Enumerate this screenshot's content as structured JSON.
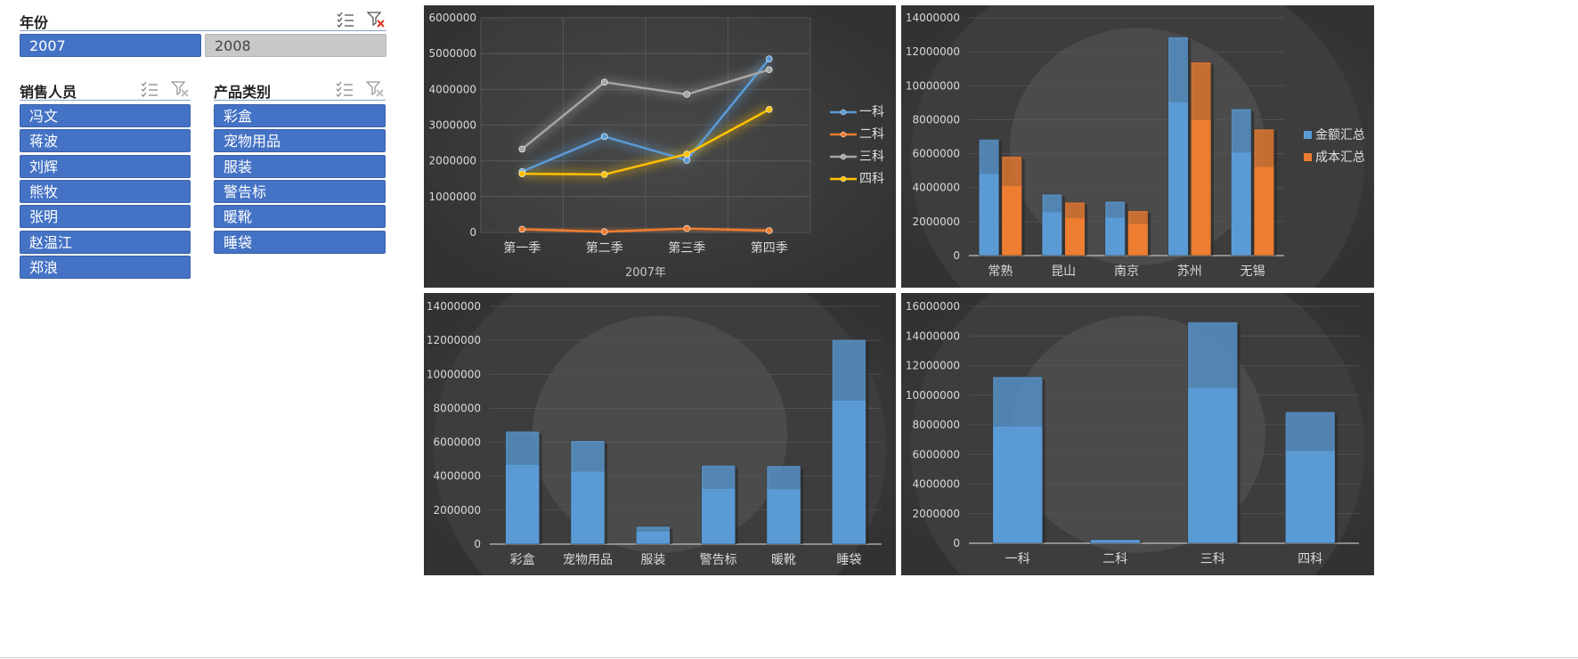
{
  "slicers": {
    "year": {
      "title": "年份",
      "items": [
        {
          "label": "2007",
          "selected": true
        },
        {
          "label": "2008",
          "selected": false
        }
      ]
    },
    "salesperson": {
      "title": "销售人员",
      "items": [
        {
          "label": "冯文",
          "selected": true
        },
        {
          "label": "蒋波",
          "selected": true
        },
        {
          "label": "刘辉",
          "selected": true
        },
        {
          "label": "熊牧",
          "selected": true
        },
        {
          "label": "张明",
          "selected": true
        },
        {
          "label": "赵温江",
          "selected": true
        },
        {
          "label": "郑浪",
          "selected": true
        }
      ]
    },
    "category": {
      "title": "产品类别",
      "items": [
        {
          "label": "彩盒",
          "selected": true
        },
        {
          "label": "宠物用品",
          "selected": true
        },
        {
          "label": "服装",
          "selected": true
        },
        {
          "label": "警告标",
          "selected": true
        },
        {
          "label": "暖靴",
          "selected": true
        },
        {
          "label": "睡袋",
          "selected": true
        }
      ]
    }
  },
  "icons": {
    "multi_select": "multi-select-icon",
    "clear_filter": "clear-filter-icon"
  },
  "colors": {
    "slicer_selected": "#4472c4",
    "slicer_unselected": "#c8c8c8",
    "chart_bg": "#3b3b3b",
    "blue": "#5b9bd5",
    "orange": "#ed7d31",
    "gray": "#a5a5a5",
    "yellow": "#ffc000"
  },
  "chart_data": [
    {
      "id": "quarterly",
      "type": "line",
      "categories": [
        "第一季",
        "第二季",
        "第三季",
        "第四季"
      ],
      "xlabel": "2007年",
      "ylim": [
        0,
        6000000
      ],
      "yticks": [
        0,
        1000000,
        2000000,
        3000000,
        4000000,
        5000000,
        6000000
      ],
      "grid": true,
      "legend": "right",
      "series": [
        {
          "name": "一科",
          "color": "#5b9bd5",
          "values": [
            1700000,
            2680000,
            2020000,
            4850000
          ]
        },
        {
          "name": "二科",
          "color": "#ed7d31",
          "values": [
            90000,
            20000,
            110000,
            50000
          ]
        },
        {
          "name": "三科",
          "color": "#a5a5a5",
          "values": [
            2330000,
            4200000,
            3860000,
            4550000
          ]
        },
        {
          "name": "四科",
          "color": "#ffc000",
          "values": [
            1640000,
            1620000,
            2190000,
            3440000
          ]
        }
      ]
    },
    {
      "id": "city",
      "type": "bar",
      "categories": [
        "常熟",
        "昆山",
        "南京",
        "苏州",
        "无锡"
      ],
      "ylim": [
        0,
        14000000
      ],
      "yticks": [
        0,
        2000000,
        4000000,
        6000000,
        8000000,
        10000000,
        12000000,
        14000000
      ],
      "legend": "right",
      "series": [
        {
          "name": "金额汇总",
          "color": "#5b9bd5",
          "values": [
            6850000,
            3620000,
            3200000,
            12880000,
            8650000
          ]
        },
        {
          "name": "成本汇总",
          "color": "#ed7d31",
          "values": [
            5850000,
            3150000,
            2650000,
            11400000,
            7450000
          ]
        }
      ]
    },
    {
      "id": "product",
      "type": "bar",
      "categories": [
        "彩盒",
        "宠物用品",
        "服装",
        "警告标",
        "暖靴",
        "睡袋"
      ],
      "ylim": [
        0,
        14000000
      ],
      "yticks": [
        0,
        2000000,
        4000000,
        6000000,
        8000000,
        10000000,
        12000000,
        14000000
      ],
      "series": [
        {
          "name": "",
          "color": "#5b9bd5",
          "values": [
            6650000,
            6100000,
            1050000,
            4650000,
            4620000,
            12050000
          ]
        }
      ]
    },
    {
      "id": "department",
      "type": "bar",
      "categories": [
        "一科",
        "二科",
        "三科",
        "四科"
      ],
      "ylim": [
        0,
        16000000
      ],
      "yticks": [
        0,
        2000000,
        4000000,
        6000000,
        8000000,
        10000000,
        12000000,
        14000000,
        16000000
      ],
      "series": [
        {
          "name": "",
          "color": "#5b9bd5",
          "values": [
            11250000,
            250000,
            14950000,
            8880000
          ]
        }
      ]
    }
  ]
}
